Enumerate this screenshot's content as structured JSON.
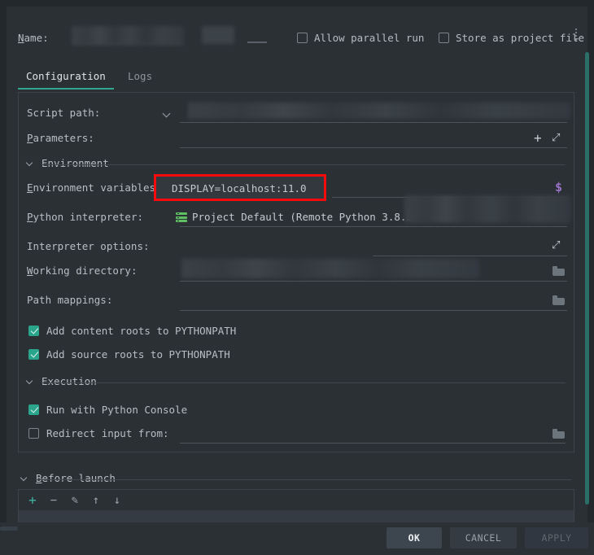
{
  "header": {
    "name_label": "Name:",
    "name_value": "",
    "allow_parallel_run": {
      "label": "Allow parallel run",
      "checked": false
    },
    "store_as_project_file": {
      "label": "Store as project file",
      "checked": false
    },
    "overflow_menu_icon": "kebab-menu-icon"
  },
  "tabs": [
    {
      "label": "Configuration",
      "active": true
    },
    {
      "label": "Logs",
      "active": false
    }
  ],
  "form": {
    "script_path": {
      "label": "Script path:",
      "value": ""
    },
    "parameters": {
      "label": "Parameters:",
      "value": ""
    },
    "environment_section": {
      "label": "Environment",
      "expanded": true
    },
    "environment_variables": {
      "label": "Environment variables:",
      "value": "DISPLAY=localhost:11.0",
      "highlighted": true,
      "highlight_color": "#f50b0b",
      "macro_icon": "dollar-macro-icon"
    },
    "python_interpreter": {
      "label": "Python interpreter:",
      "value": "Project Default (Remote Python 3.8.5",
      "icon": "remote-interpreter-icon"
    },
    "interpreter_options": {
      "label": "Interpreter options:",
      "value": ""
    },
    "working_directory": {
      "label": "Working directory:",
      "value": ""
    },
    "path_mappings": {
      "label": "Path mappings:",
      "value": ""
    },
    "add_content_roots": {
      "label": "Add content roots to PYTHONPATH",
      "checked": true
    },
    "add_source_roots": {
      "label": "Add source roots to PYTHONPATH",
      "checked": true
    },
    "execution_section": {
      "label": "Execution",
      "expanded": true
    },
    "run_with_python_console": {
      "label": "Run with Python Console",
      "checked": true
    },
    "redirect_input_from": {
      "label": "Redirect input from:",
      "checked": false,
      "value": ""
    }
  },
  "before_launch": {
    "label": "Before launch",
    "expanded": true,
    "toolbar": [
      {
        "name": "add-button",
        "glyph": "+"
      },
      {
        "name": "remove-button",
        "glyph": "−"
      },
      {
        "name": "edit-button",
        "glyph": "✎"
      },
      {
        "name": "move-up-button",
        "glyph": "↑"
      },
      {
        "name": "move-down-button",
        "glyph": "↓"
      }
    ]
  },
  "footer": {
    "ok": "OK",
    "cancel": "CANCEL",
    "apply": "APPLY",
    "apply_enabled": false
  },
  "colors": {
    "background": "#2b3035",
    "accent": "#2ea88f",
    "highlight": "#f50b0b",
    "macro": "#9a72c6"
  }
}
